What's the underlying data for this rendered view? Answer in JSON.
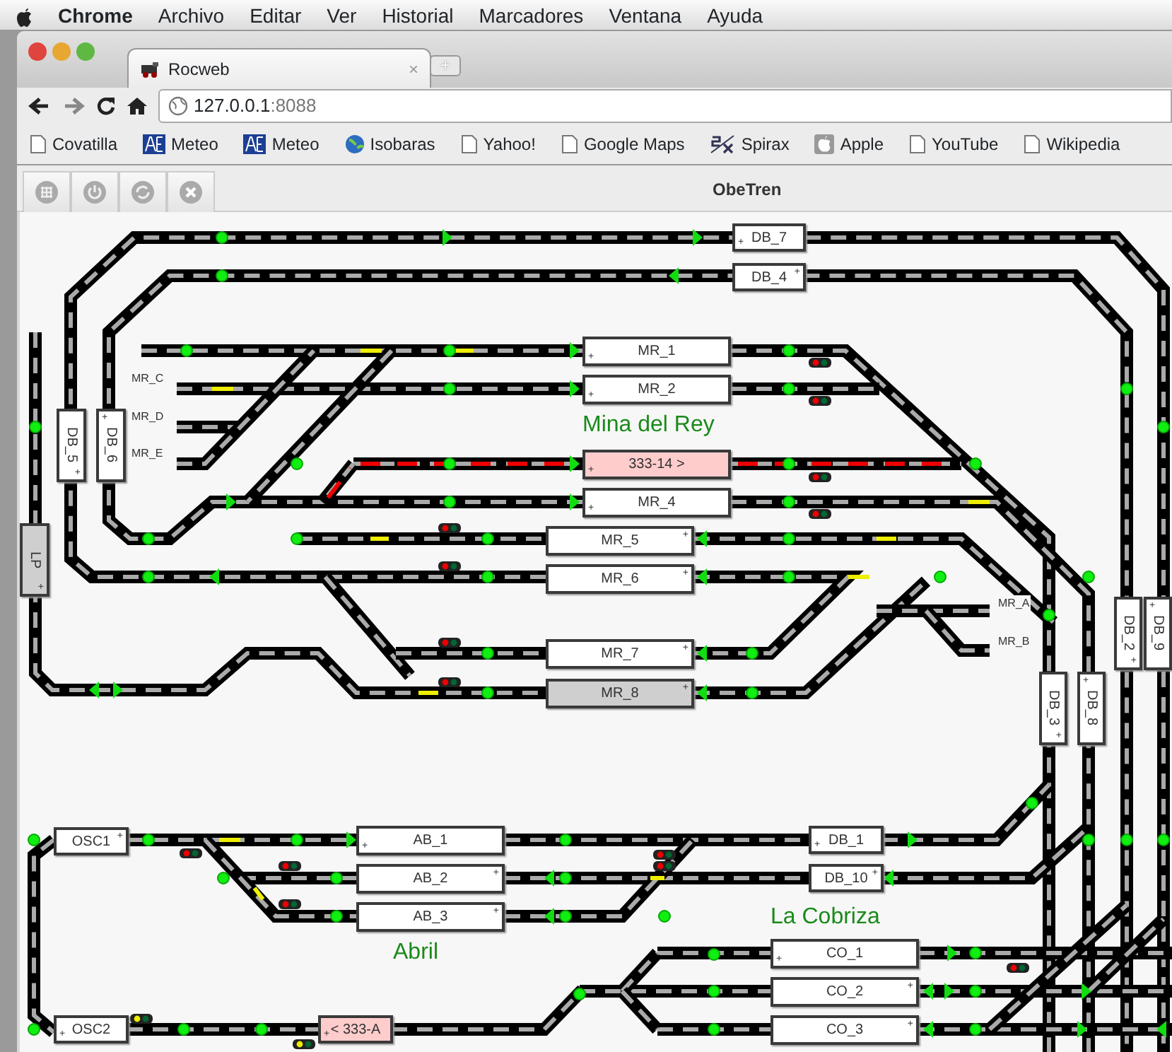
{
  "menu_bar": {
    "app": "Chrome",
    "items": [
      "Archivo",
      "Editar",
      "Ver",
      "Historial",
      "Marcadores",
      "Ventana",
      "Ayuda"
    ]
  },
  "browser": {
    "tab": {
      "title": "Rocweb",
      "close": "×"
    },
    "new_tab": "+",
    "url": {
      "host": "127.0.0.1",
      "port": ":8088"
    },
    "bookmarks": [
      "Covatilla",
      "Meteo",
      "Meteo",
      "Isobaras",
      "Yahoo!",
      "Google Maps",
      "Spirax",
      "Apple",
      "YouTube",
      "Wikipedia"
    ]
  },
  "app": {
    "title": "ObeTren"
  },
  "layout": {
    "blocks": [
      {
        "label": "DB_7",
        "kind": "horizontal",
        "occupied": false,
        "reserved": false,
        "plus": "+",
        "plus_top": false
      },
      {
        "label": "DB_4",
        "kind": "horizontal",
        "occupied": false,
        "reserved": false,
        "plus": "+",
        "plus_top": true
      },
      {
        "label": "MR_1",
        "kind": "horizontal",
        "occupied": false,
        "reserved": false,
        "plus": "+",
        "plus_top": false
      },
      {
        "label": "MR_2",
        "kind": "horizontal",
        "occupied": false,
        "reserved": false,
        "plus": "+",
        "plus_top": false
      },
      {
        "label": "DB_5",
        "kind": "vertical",
        "occupied": false,
        "reserved": false,
        "plus": "+",
        "plus_top": false
      },
      {
        "label": "DB_6",
        "kind": "vertical",
        "occupied": false,
        "reserved": false,
        "plus": "+",
        "plus_top": true
      },
      {
        "label": "333-14 >",
        "kind": "horizontal",
        "occupied": true,
        "reserved": false,
        "plus": "+",
        "plus_top": false
      },
      {
        "label": "MR_4",
        "kind": "horizontal",
        "occupied": false,
        "reserved": false,
        "plus": "+",
        "plus_top": false
      },
      {
        "label": "LP",
        "kind": "vertical",
        "occupied": false,
        "reserved": true,
        "plus": "+",
        "plus_top": false
      },
      {
        "label": "MR_5",
        "kind": "horizontal",
        "occupied": false,
        "reserved": false,
        "plus": "+",
        "plus_top": true
      },
      {
        "label": "MR_6",
        "kind": "horizontal",
        "occupied": false,
        "reserved": false,
        "plus": "+",
        "plus_top": true
      },
      {
        "label": "DB_2",
        "kind": "vertical",
        "occupied": false,
        "reserved": false,
        "plus": "+",
        "plus_top": false
      },
      {
        "label": "DB_9",
        "kind": "vertical",
        "occupied": false,
        "reserved": false,
        "plus": "+",
        "plus_top": true
      },
      {
        "label": "MR_7",
        "kind": "horizontal",
        "occupied": false,
        "reserved": false,
        "plus": "+",
        "plus_top": true
      },
      {
        "label": "DB_3",
        "kind": "vertical",
        "occupied": false,
        "reserved": false,
        "plus": "+",
        "plus_top": false
      },
      {
        "label": "DB_8",
        "kind": "vertical",
        "occupied": false,
        "reserved": false,
        "plus": "+",
        "plus_top": true
      },
      {
        "label": "MR_8",
        "kind": "horizontal",
        "occupied": false,
        "reserved": true,
        "plus": "+",
        "plus_top": true
      },
      {
        "label": "OSC1",
        "kind": "horizontal",
        "occupied": false,
        "reserved": false,
        "plus": "+",
        "plus_top": true
      },
      {
        "label": "AB_1",
        "kind": "horizontal",
        "occupied": false,
        "reserved": false,
        "plus": "+",
        "plus_top": false
      },
      {
        "label": "DB_1",
        "kind": "horizontal",
        "occupied": false,
        "reserved": false,
        "plus": "+",
        "plus_top": false
      },
      {
        "label": "AB_2",
        "kind": "horizontal",
        "occupied": false,
        "reserved": false,
        "plus": "+",
        "plus_top": true
      },
      {
        "label": "DB_10",
        "kind": "horizontal",
        "occupied": false,
        "reserved": false,
        "plus": "+",
        "plus_top": true
      },
      {
        "label": "AB_3",
        "kind": "horizontal",
        "occupied": false,
        "reserved": false,
        "plus": "+",
        "plus_top": true
      },
      {
        "label": "CO_1",
        "kind": "horizontal",
        "occupied": false,
        "reserved": false,
        "plus": "+",
        "plus_top": false
      },
      {
        "label": "CO_2",
        "kind": "horizontal",
        "occupied": false,
        "reserved": false,
        "plus": "+",
        "plus_top": true
      },
      {
        "label": "OSC2",
        "kind": "horizontal",
        "occupied": false,
        "reserved": false,
        "plus": "+",
        "plus_top": false
      },
      {
        "label": "< 333-A",
        "kind": "horizontal",
        "occupied": true,
        "reserved": false,
        "plus": "+",
        "plus_top": false
      },
      {
        "label": "CO_3",
        "kind": "horizontal",
        "occupied": false,
        "reserved": false,
        "plus": "+",
        "plus_top": true
      }
    ],
    "track_labels": [
      "MR_C",
      "MR_D",
      "MR_E",
      "MR_A",
      "MR_B"
    ],
    "stations": [
      "Mina del Rey",
      "Abril",
      "La Cobriza"
    ]
  }
}
